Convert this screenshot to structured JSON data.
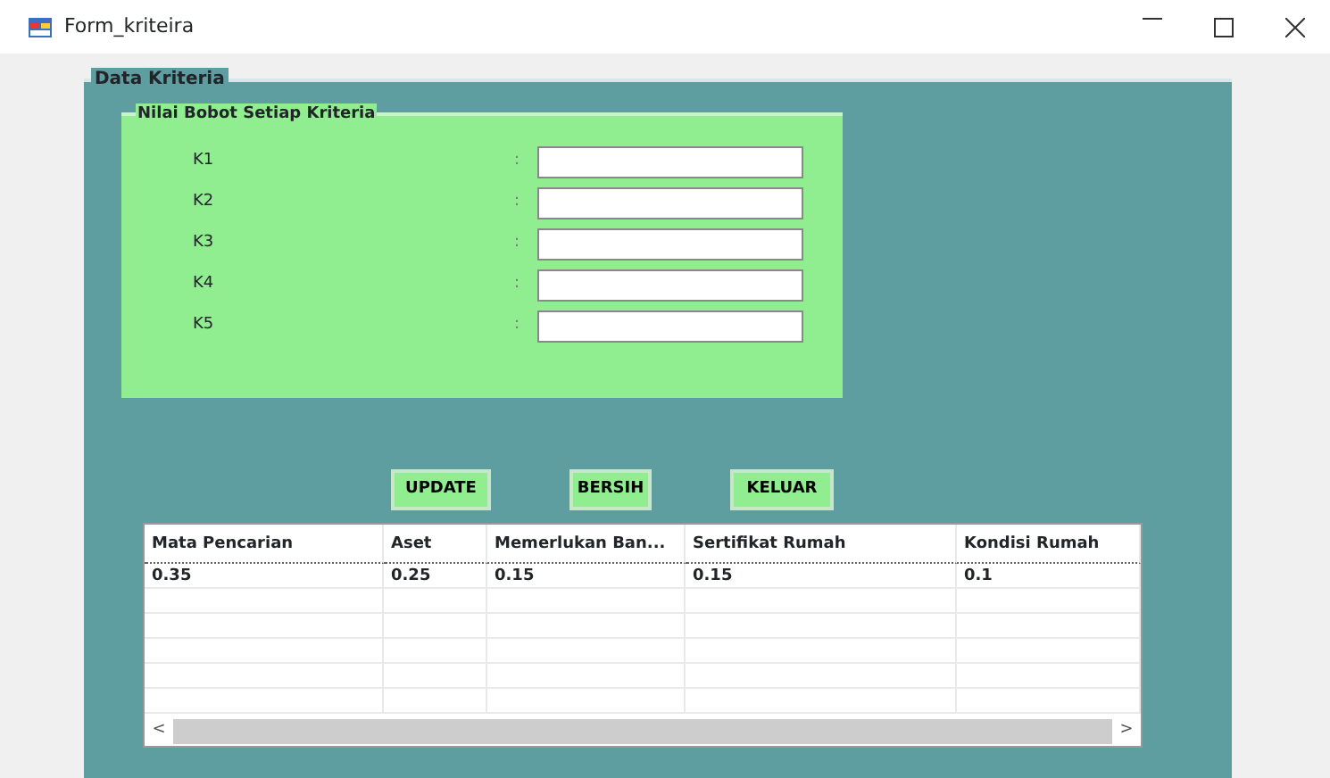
{
  "window": {
    "title": "Form_kriteira"
  },
  "group": {
    "title": "Data Kriteria"
  },
  "panel": {
    "title": "Nilai Bobot Setiap Kriteria",
    "fields": [
      {
        "label": "K1",
        "separator": ":"
      },
      {
        "label": "K2",
        "separator": ":"
      },
      {
        "label": "K3",
        "separator": ":"
      },
      {
        "label": "K4",
        "separator": ":"
      },
      {
        "label": "K5",
        "separator": ":"
      }
    ]
  },
  "buttons": [
    "UPDATE",
    "BERSIH",
    "KELUAR"
  ],
  "table": {
    "columns": [
      "Mata Pencarian",
      "Aset",
      "Memerlukan Ban...",
      "Sertifikat Rumah",
      "Kondisi Rumah"
    ],
    "rows": [
      [
        "0.35",
        "0.25",
        "0.15",
        "0.15",
        "0.1"
      ]
    ]
  },
  "scrollbar": {
    "left": "<",
    "right": ">"
  }
}
